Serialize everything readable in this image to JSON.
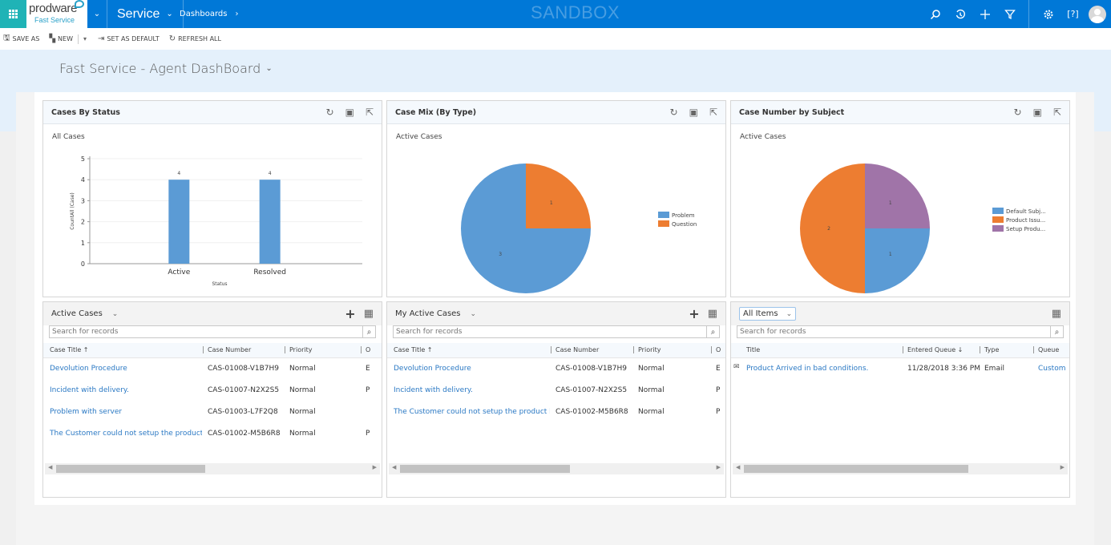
{
  "topbar": {
    "brand": "prodware",
    "brand_sub": "Fast Service",
    "module": "Service",
    "breadcrumb": "Dashboards",
    "environment": "SANDBOX",
    "icons": [
      "search-icon",
      "recent-icon",
      "new-icon",
      "filter-icon",
      "settings-icon",
      "help-icon",
      "user-avatar"
    ]
  },
  "commands": {
    "save_as": "SAVE AS",
    "new": "NEW",
    "set_default": "SET AS DEFAULT",
    "refresh_all": "REFRESH ALL"
  },
  "page": {
    "title": "Fast Service - Agent DashBoard"
  },
  "colors": {
    "accent": "#0078d7",
    "blue": "#5b9bd5",
    "orange": "#ed7d31",
    "purple": "#a074a8",
    "link": "#2b79c4"
  },
  "chart_data": [
    {
      "type": "bar",
      "panel_title": "Cases By Status",
      "title": "All Cases",
      "categories": [
        "Active",
        "Resolved"
      ],
      "values": [
        4,
        4
      ],
      "data_labels": [
        "4",
        "4"
      ],
      "xlabel": "Status",
      "ylabel": "CountAll (Case)",
      "ylim": [
        0,
        5
      ],
      "yticks": [
        "0",
        "1",
        "2",
        "3",
        "4",
        "5"
      ],
      "grid": true
    },
    {
      "type": "pie",
      "panel_title": "Case Mix (By Type)",
      "title": "Active Cases",
      "categories": [
        "Problem",
        "Question"
      ],
      "values": [
        3,
        1
      ],
      "colors": [
        "#5b9bd5",
        "#ed7d31"
      ],
      "legend": "right"
    },
    {
      "type": "pie",
      "panel_title": "Case Number by Subject",
      "title": "Active Cases",
      "categories": [
        "Default Subj...",
        "Product Issu...",
        "Setup Produ..."
      ],
      "values": [
        1,
        2,
        1
      ],
      "colors": [
        "#5b9bd5",
        "#ed7d31",
        "#a074a8"
      ],
      "legend": "right"
    }
  ],
  "lists": [
    {
      "view": "Active Cases",
      "search_placeholder": "Search for records",
      "columns": [
        "Case Title ↑",
        "Case Number",
        "Priority",
        "O"
      ],
      "rows": [
        [
          "Devolution Procedure",
          "CAS-01008-V1B7H9",
          "Normal",
          "E"
        ],
        [
          "Incident with delivery.",
          "CAS-01007-N2X2S5",
          "Normal",
          "P"
        ],
        [
          "Problem with server",
          "CAS-01003-L7F2Q8",
          "Normal",
          ""
        ],
        [
          "The Customer could not setup the product b...",
          "CAS-01002-M5B6R8",
          "Normal",
          "P"
        ]
      ]
    },
    {
      "view": "My Active Cases",
      "search_placeholder": "Search for records",
      "columns": [
        "Case Title ↑",
        "Case Number",
        "Priority",
        "O"
      ],
      "rows": [
        [
          "Devolution Procedure",
          "CAS-01008-V1B7H9",
          "Normal",
          "E"
        ],
        [
          "Incident with delivery.",
          "CAS-01007-N2X2S5",
          "Normal",
          "P"
        ],
        [
          "The Customer could not setup the product b...",
          "CAS-01002-M5B6R8",
          "Normal",
          "P"
        ]
      ]
    },
    {
      "view": "All Items",
      "search_placeholder": "Search for records",
      "columns": [
        "Title",
        "Entered Queue ↓",
        "Type",
        "Queue"
      ],
      "rows": [
        [
          "Product Arrived in bad conditions.",
          "11/28/2018 3:36 PM",
          "Email",
          "Custom"
        ]
      ]
    }
  ]
}
